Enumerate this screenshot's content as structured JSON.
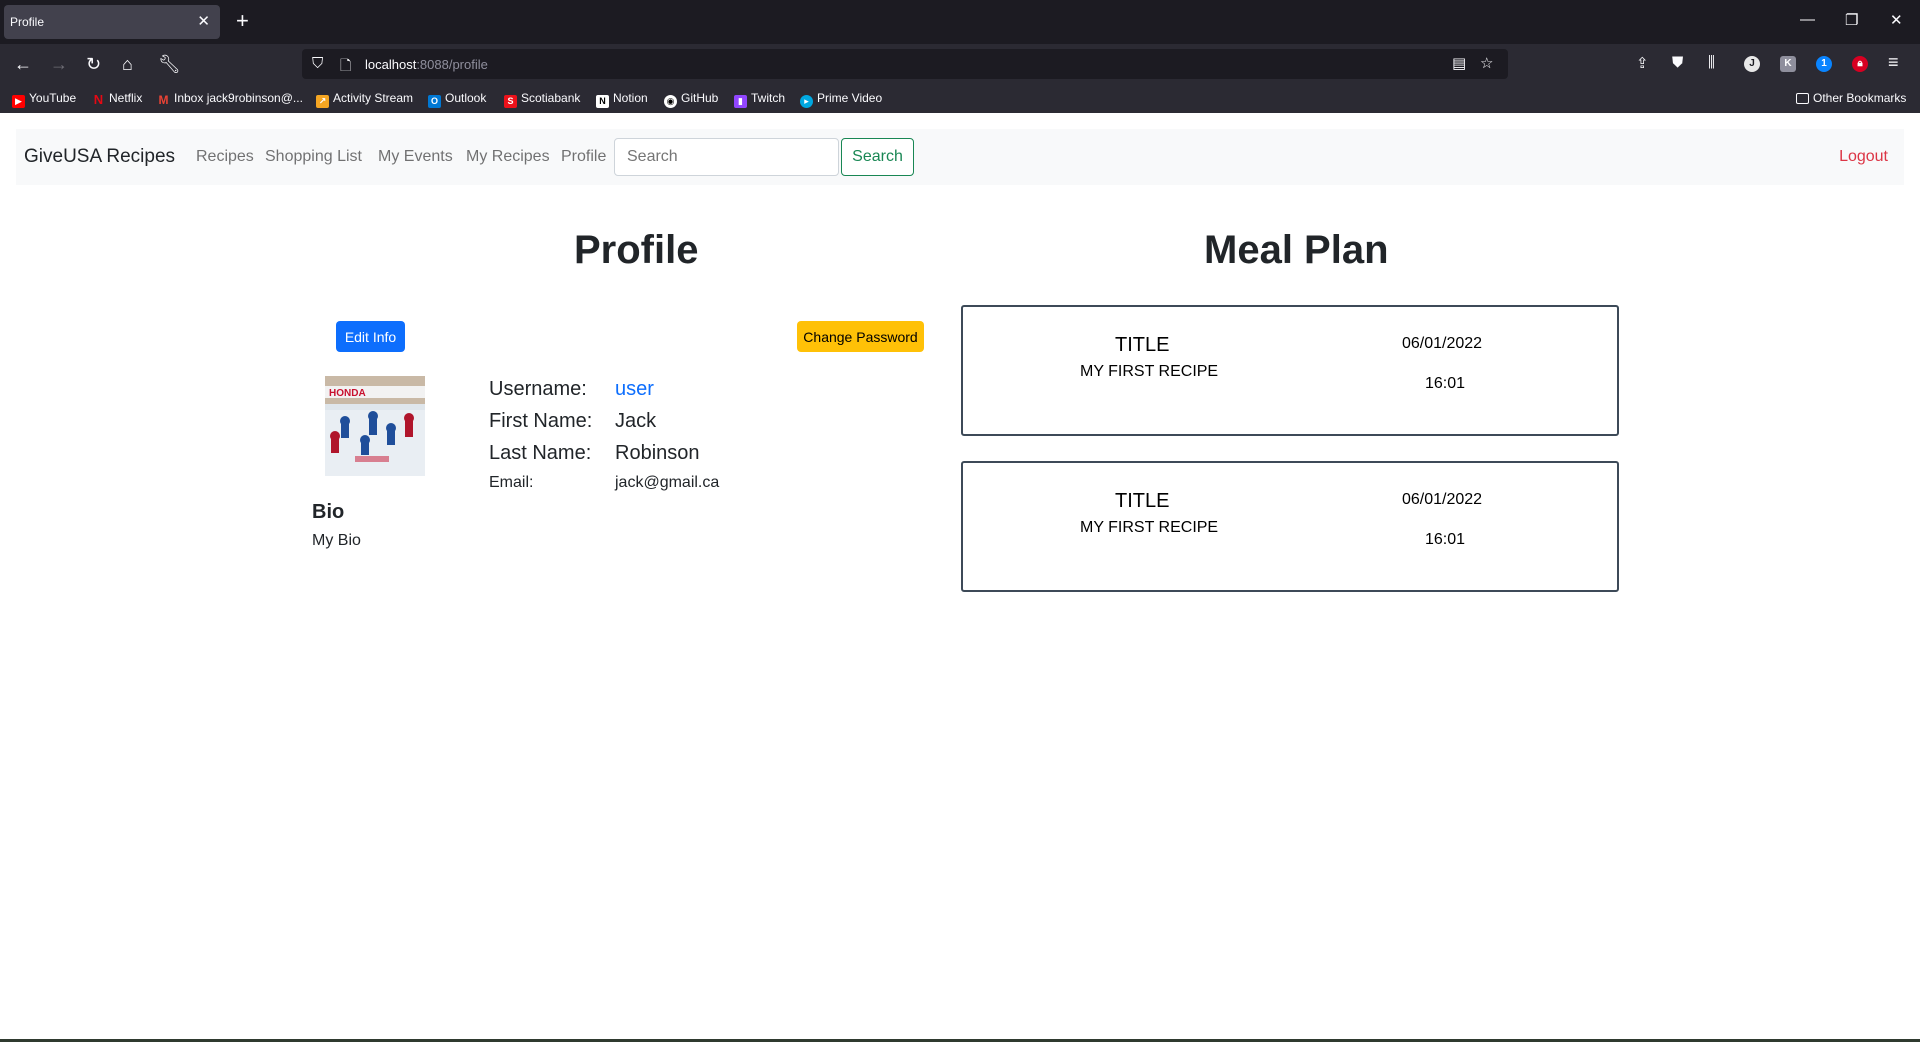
{
  "browser": {
    "tab_title": "Profile",
    "tab_close": "✕",
    "new_tab": "+",
    "url_host": "localhost",
    "url_path": ":8088/profile",
    "window_controls": [
      "—",
      "❐",
      "✕"
    ],
    "bookmarks": [
      {
        "label": "YouTube",
        "icon": "youtube-icon",
        "color": "#ff0000"
      },
      {
        "label": "Netflix",
        "icon": "netflix-icon",
        "color": "#e50914"
      },
      {
        "label": "Inbox jack9robinson@...",
        "icon": "gmail-icon",
        "color": "#ea4335"
      },
      {
        "label": "Activity Stream",
        "icon": "activity-stream-icon",
        "color": "#f5a623"
      },
      {
        "label": "Outlook",
        "icon": "outlook-icon",
        "color": "#0078d4"
      },
      {
        "label": "Scotiabank",
        "icon": "scotiabank-icon",
        "color": "#ec111a"
      },
      {
        "label": "Notion",
        "icon": "notion-icon",
        "color": "#ffffff"
      },
      {
        "label": "GitHub",
        "icon": "github-icon",
        "color": "#ffffff"
      },
      {
        "label": "Twitch",
        "icon": "twitch-icon",
        "color": "#9146ff"
      },
      {
        "label": "Prime Video",
        "icon": "prime-video-icon",
        "color": "#00a8e1"
      }
    ],
    "other_bookmarks": "Other Bookmarks"
  },
  "app": {
    "brand": "GiveUSA Recipes",
    "nav": [
      "Recipes",
      "Shopping List",
      "My Events",
      "My Recipes",
      "Profile"
    ],
    "search_placeholder": "Search",
    "search_button": "Search",
    "logout": "Logout"
  },
  "profile": {
    "heading": "Profile",
    "edit_button": "Edit Info",
    "change_password_button": "Change Password",
    "fields": {
      "username_label": "Username:",
      "username": "user",
      "first_name_label": "First Name:",
      "first_name": "Jack",
      "last_name_label": "Last Name:",
      "last_name": "Robinson",
      "email_label": "Email:",
      "email": "jack@gmail.ca"
    },
    "bio_heading": "Bio",
    "bio": "My Bio"
  },
  "meal_plan": {
    "heading": "Meal Plan",
    "items": [
      {
        "title_label": "TITLE",
        "recipe": "MY FIRST RECIPE",
        "date": "06/01/2022",
        "time": "16:01"
      },
      {
        "title_label": "TITLE",
        "recipe": "MY FIRST RECIPE",
        "date": "06/01/2022",
        "time": "16:01"
      }
    ]
  },
  "colors": {
    "primary": "#0d6efd",
    "warning": "#ffc107",
    "success": "#198754",
    "danger": "#dc3545",
    "browser_dark": "#1c1b22"
  }
}
